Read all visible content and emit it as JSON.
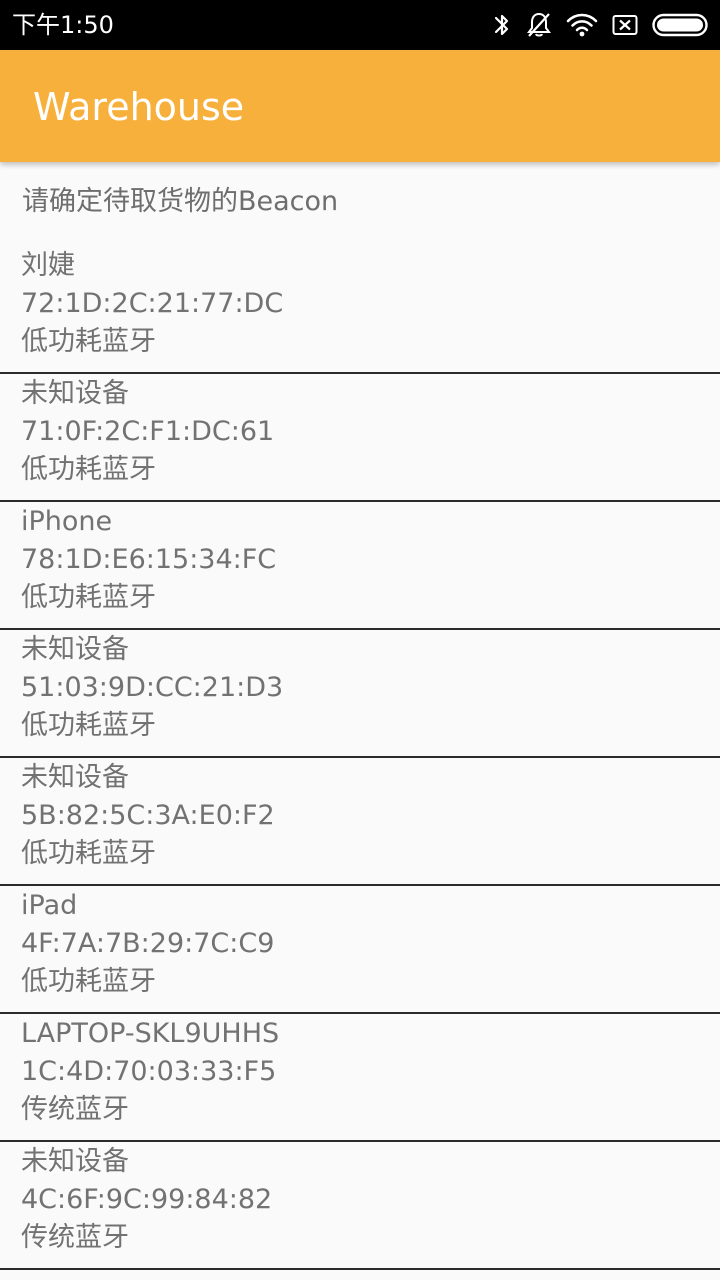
{
  "status_bar": {
    "time": "下午1:50",
    "icons": [
      "bluetooth-icon",
      "do-not-disturb-icon",
      "wifi-icon",
      "sim-off-icon",
      "battery-icon"
    ]
  },
  "app_bar": {
    "title": "Warehouse",
    "color": "#f8b03d"
  },
  "prompt": "请确定待取货物的Beacon",
  "devices": [
    {
      "name": "刘婕",
      "address": "72:1D:2C:21:77:DC",
      "type": "低功耗蓝牙"
    },
    {
      "name": "未知设备",
      "address": "71:0F:2C:F1:DC:61",
      "type": "低功耗蓝牙"
    },
    {
      "name": "iPhone",
      "address": "78:1D:E6:15:34:FC",
      "type": "低功耗蓝牙"
    },
    {
      "name": "未知设备",
      "address": "51:03:9D:CC:21:D3",
      "type": "低功耗蓝牙"
    },
    {
      "name": "未知设备",
      "address": "5B:82:5C:3A:E0:F2",
      "type": "低功耗蓝牙"
    },
    {
      "name": "iPad",
      "address": "4F:7A:7B:29:7C:C9",
      "type": "低功耗蓝牙"
    },
    {
      "name": "LAPTOP-SKL9UHHS",
      "address": "1C:4D:70:03:33:F5",
      "type": "传统蓝牙"
    },
    {
      "name": "未知设备",
      "address": "4C:6F:9C:99:84:82",
      "type": "传统蓝牙"
    }
  ]
}
